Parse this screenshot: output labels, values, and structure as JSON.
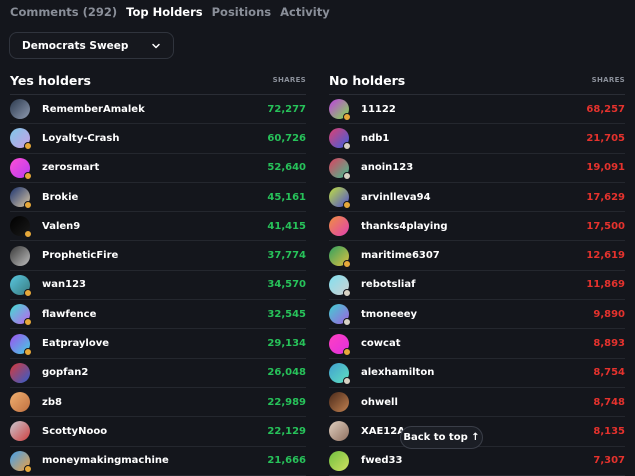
{
  "tabs": [
    {
      "label": "Comments (292)",
      "active": false
    },
    {
      "label": "Top Holders",
      "active": true
    },
    {
      "label": "Positions",
      "active": false
    },
    {
      "label": "Activity",
      "active": false
    }
  ],
  "outcome_select": {
    "value": "Democrats Sweep"
  },
  "yes_column": {
    "title": "Yes holders",
    "shares_label": "SHARES",
    "rows": [
      {
        "name": "RememberAmalek",
        "shares": "72,277",
        "colors": [
          "#2c3a4e",
          "#8e9ab0"
        ],
        "badge": "none"
      },
      {
        "name": "Loyalty-Crash",
        "shares": "60,726",
        "colors": [
          "#7ec8e8",
          "#c99ee6"
        ],
        "badge": "gold"
      },
      {
        "name": "zerosmart",
        "shares": "52,640",
        "colors": [
          "#ff4fd6",
          "#b83cf0"
        ],
        "badge": "gold"
      },
      {
        "name": "Brokie",
        "shares": "45,161",
        "colors": [
          "#1c3470",
          "#d8c6a4"
        ],
        "badge": "gold"
      },
      {
        "name": "Valen9",
        "shares": "41,415",
        "colors": [
          "#000000",
          "#1a1a1a"
        ],
        "badge": "gold"
      },
      {
        "name": "PropheticFire",
        "shares": "37,774",
        "colors": [
          "#3a3a3a",
          "#bdbdbd"
        ],
        "badge": "none"
      },
      {
        "name": "wan123",
        "shares": "34,570",
        "colors": [
          "#58c7e0",
          "#3a7a7e"
        ],
        "badge": "gold"
      },
      {
        "name": "flawfence",
        "shares": "32,545",
        "colors": [
          "#3fe0d0",
          "#c060f0"
        ],
        "badge": "gold"
      },
      {
        "name": "Eatpraylove",
        "shares": "29,134",
        "colors": [
          "#a050f0",
          "#40d0e0"
        ],
        "badge": "gold"
      },
      {
        "name": "gopfan2",
        "shares": "26,048",
        "colors": [
          "#d93838",
          "#2f5fd0"
        ],
        "badge": "none"
      },
      {
        "name": "zb8",
        "shares": "22,989",
        "colors": [
          "#f0b070",
          "#c07040"
        ],
        "badge": "none"
      },
      {
        "name": "ScottyNooo",
        "shares": "22,129",
        "colors": [
          "#c8c8d0",
          "#d04040"
        ],
        "badge": "none"
      },
      {
        "name": "moneymakingmachine",
        "shares": "21,666",
        "colors": [
          "#40a0f0",
          "#f0a040"
        ],
        "badge": "gold"
      }
    ]
  },
  "no_column": {
    "title": "No holders",
    "shares_label": "SHARES",
    "rows": [
      {
        "name": "11122",
        "shares": "68,257",
        "colors": [
          "#c040e0",
          "#80e050"
        ],
        "badge": "gold"
      },
      {
        "name": "ndb1",
        "shares": "21,705",
        "colors": [
          "#e04070",
          "#3a60e0"
        ],
        "badge": "silver"
      },
      {
        "name": "anoin123",
        "shares": "19,091",
        "colors": [
          "#e04060",
          "#40c090"
        ],
        "badge": "silver"
      },
      {
        "name": "arvinlleva94",
        "shares": "17,629",
        "colors": [
          "#c0e040",
          "#5050d0"
        ],
        "badge": "gold"
      },
      {
        "name": "thanks4playing",
        "shares": "17,500",
        "colors": [
          "#f09040",
          "#e040b0"
        ],
        "badge": "none"
      },
      {
        "name": "maritime6307",
        "shares": "12,619",
        "colors": [
          "#2fa060",
          "#e0c040"
        ],
        "badge": "gold"
      },
      {
        "name": "rebotsliaf",
        "shares": "11,869",
        "colors": [
          "#80e0f0",
          "#d0d0d0"
        ],
        "badge": "silver"
      },
      {
        "name": "tmoneeey",
        "shares": "9,890",
        "colors": [
          "#40d0d0",
          "#a060e0"
        ],
        "badge": "silver"
      },
      {
        "name": "cowcat",
        "shares": "8,893",
        "colors": [
          "#ff40c0",
          "#e030e0"
        ],
        "badge": "gold"
      },
      {
        "name": "alexhamilton",
        "shares": "8,754",
        "colors": [
          "#40a0d0",
          "#60e0c0"
        ],
        "badge": "silver"
      },
      {
        "name": "ohwell",
        "shares": "8,748",
        "colors": [
          "#4a2a1a",
          "#c08050"
        ],
        "badge": "none"
      },
      {
        "name": "XAE12Arc",
        "shares": "8,135",
        "colors": [
          "#e0d0c0",
          "#907060"
        ],
        "badge": "none"
      },
      {
        "name": "fwed33",
        "shares": "7,307",
        "colors": [
          "#70c040",
          "#d0e060"
        ],
        "badge": "none"
      }
    ]
  },
  "back_to_top": {
    "label": "Back to top ↑"
  }
}
